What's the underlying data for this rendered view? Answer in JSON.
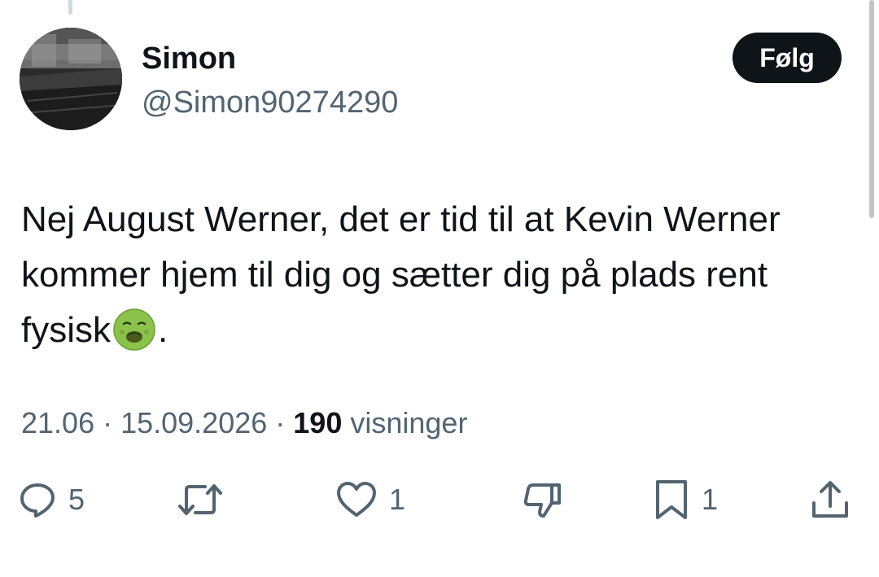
{
  "tweet": {
    "author": {
      "name": "Simon",
      "handle": "@Simon90274290"
    },
    "follow_label": "Følg",
    "text_before_emoji": "Nej August Werner, det er tid til at Kevin Werner kommer hjem til dig og sætter dig på plads rent fysisk",
    "emoji": "nauseated-face",
    "text_after_emoji": ".",
    "time": "21.06",
    "date": "15.09.2026",
    "separator": " · ",
    "views_count": "190",
    "views_label": "visninger"
  },
  "actions": {
    "replies": "5",
    "reposts": "",
    "likes": "1",
    "dislike": "",
    "bookmarks": "1",
    "share": ""
  },
  "colors": {
    "text_primary": "#0f1419",
    "text_secondary": "#536471",
    "follow_bg": "#0f1419",
    "emoji_green": "#8bc34a"
  }
}
